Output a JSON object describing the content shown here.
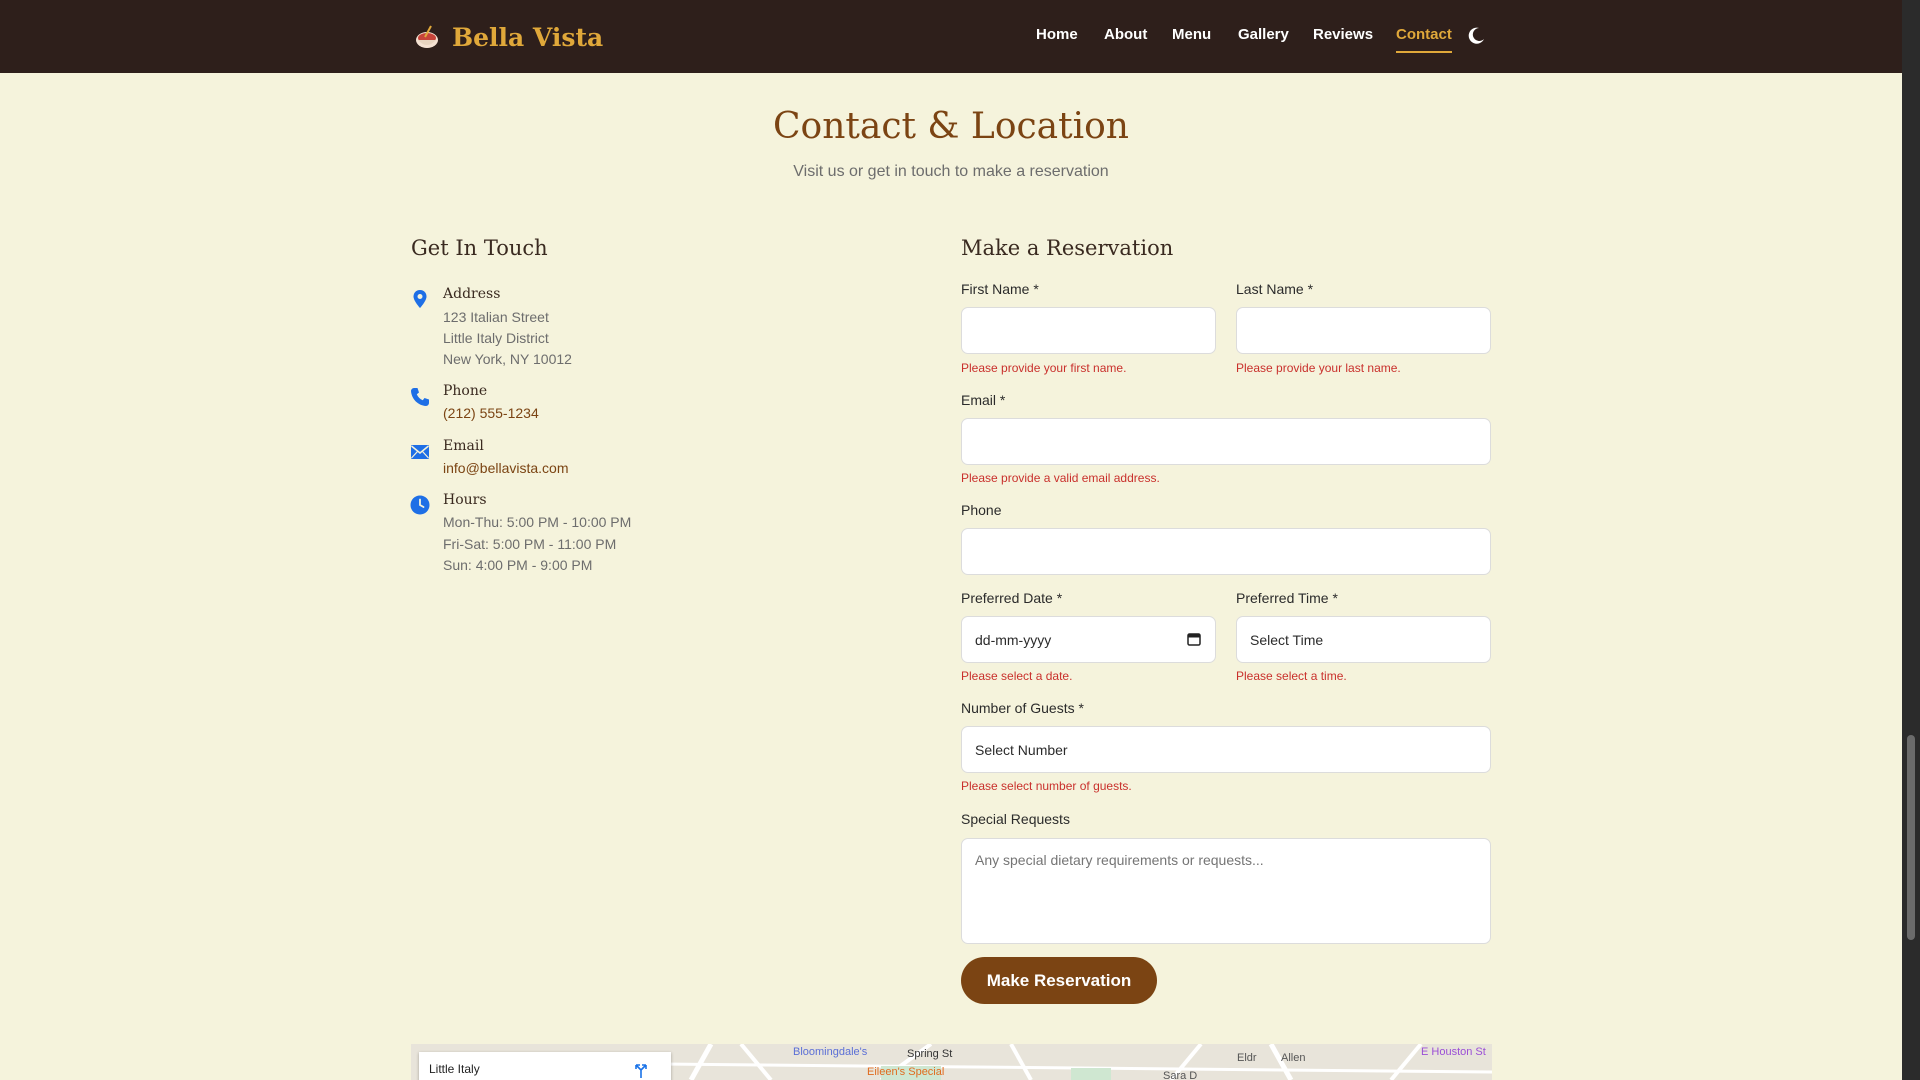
{
  "nav": {
    "brand": "Bella Vista",
    "links": [
      "Home",
      "About",
      "Menu",
      "Gallery",
      "Reviews",
      "Contact"
    ],
    "active": "Contact"
  },
  "header": {
    "title": "Contact & Location",
    "subtitle": "Visit us or get in touch to make a reservation"
  },
  "contact": {
    "title": "Get In Touch",
    "address_label": "Address",
    "address_lines": [
      "123 Italian Street",
      "Little Italy District",
      "New York, NY 10012"
    ],
    "phone_label": "Phone",
    "phone": "(212) 555-1234",
    "email_label": "Email",
    "email": "info@bellavista.com",
    "hours_label": "Hours",
    "hours_lines": [
      "Mon-Thu: 5:00 PM - 10:00 PM",
      "Fri-Sat: 5:00 PM - 11:00 PM",
      "Sun: 4:00 PM - 9:00 PM"
    ]
  },
  "form": {
    "title": "Make a Reservation",
    "first_name_label": "First Name *",
    "first_name_value": "",
    "first_name_error": "Please provide your first name.",
    "last_name_label": "Last Name *",
    "last_name_value": "",
    "last_name_error": "Please provide your last name.",
    "email_label": "Email *",
    "email_value": "",
    "email_error": "Please provide a valid email address.",
    "phone_label": "Phone",
    "phone_value": "",
    "date_label": "Preferred Date *",
    "date_placeholder": "dd-mm-yyyy",
    "date_error": "Please select a date.",
    "time_label": "Preferred Time *",
    "time_selected": "Select Time",
    "time_error": "Please select a time.",
    "guests_label": "Number of Guests *",
    "guests_selected": "Select Number",
    "guests_error": "Please select number of guests.",
    "requests_label": "Special Requests",
    "requests_placeholder": "Any special dietary requirements or requests...",
    "submit_label": "Make Reservation"
  },
  "map": {
    "place": "Little Italy",
    "labels": [
      "Bloomingdale's",
      "Spring St",
      "Eileen's Special",
      "E Houston St",
      "Sara D",
      "Allen",
      "Eldr"
    ]
  },
  "colors": {
    "nav_bg": "#2e1f1b",
    "accent": "#e0a83a",
    "brand_brown": "#7b4413",
    "page_bg": "#f5f3dc",
    "error": "#c9302c",
    "icon_blue": "#1e6fe6"
  }
}
